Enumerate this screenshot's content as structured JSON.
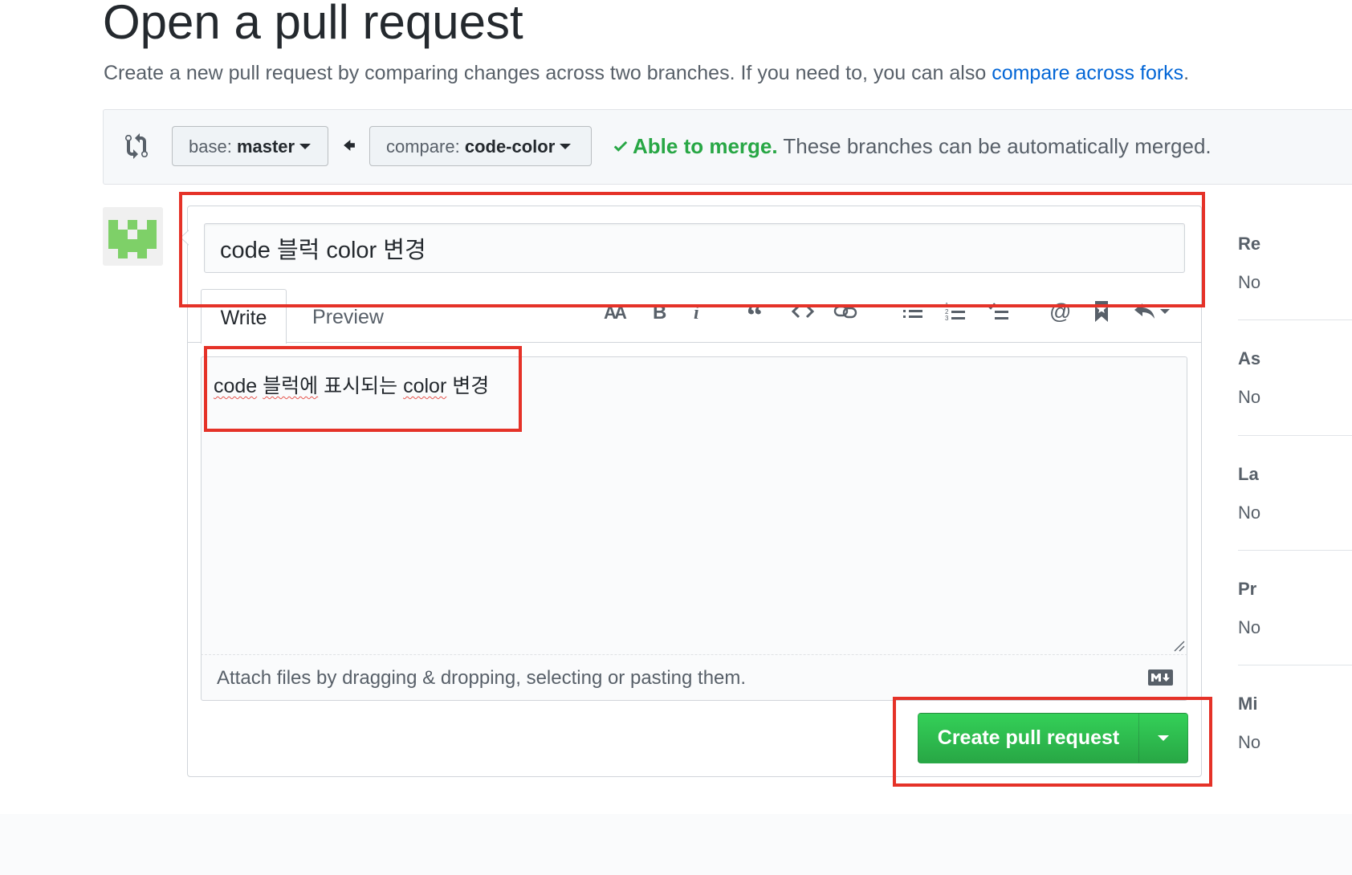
{
  "page": {
    "title": "Open a pull request",
    "subtitle_prefix": "Create a new pull request by comparing changes across two branches. If you need to, you can also ",
    "subtitle_link": "compare across forks",
    "subtitle_suffix": "."
  },
  "range": {
    "base_prefix": "base: ",
    "base_branch": "master",
    "compare_prefix": "compare: ",
    "compare_branch": "code-color",
    "merge_ok": "Able to merge.",
    "merge_note": " These branches can be automatically merged."
  },
  "form": {
    "title_value": "code 블럭 color 변경",
    "tabs": {
      "write": "Write",
      "preview": "Preview"
    },
    "body_parts": [
      "code",
      " ",
      "블럭에",
      " 표시되는 ",
      "color",
      " 변경"
    ],
    "attach_text": "Attach files by dragging & dropping, selecting or pasting them.",
    "toolbar": [
      "header-icon",
      "bold-icon",
      "italic-icon",
      "quote-icon",
      "code-icon",
      "link-icon",
      "unordered-list-icon",
      "ordered-list-icon",
      "task-list-icon",
      "mention-icon",
      "reference-icon",
      "reply-icon"
    ],
    "submit_label": "Create pull request"
  },
  "sidebar": [
    {
      "head": "Re",
      "value": "No"
    },
    {
      "head": "As",
      "value": "No"
    },
    {
      "head": "La",
      "value": "No"
    },
    {
      "head": "Pr",
      "value": "No"
    },
    {
      "head": "Mi",
      "value": "No"
    }
  ],
  "colors": {
    "accent_link": "#0366d6",
    "success": "#28a745",
    "annotation": "#e53228"
  }
}
